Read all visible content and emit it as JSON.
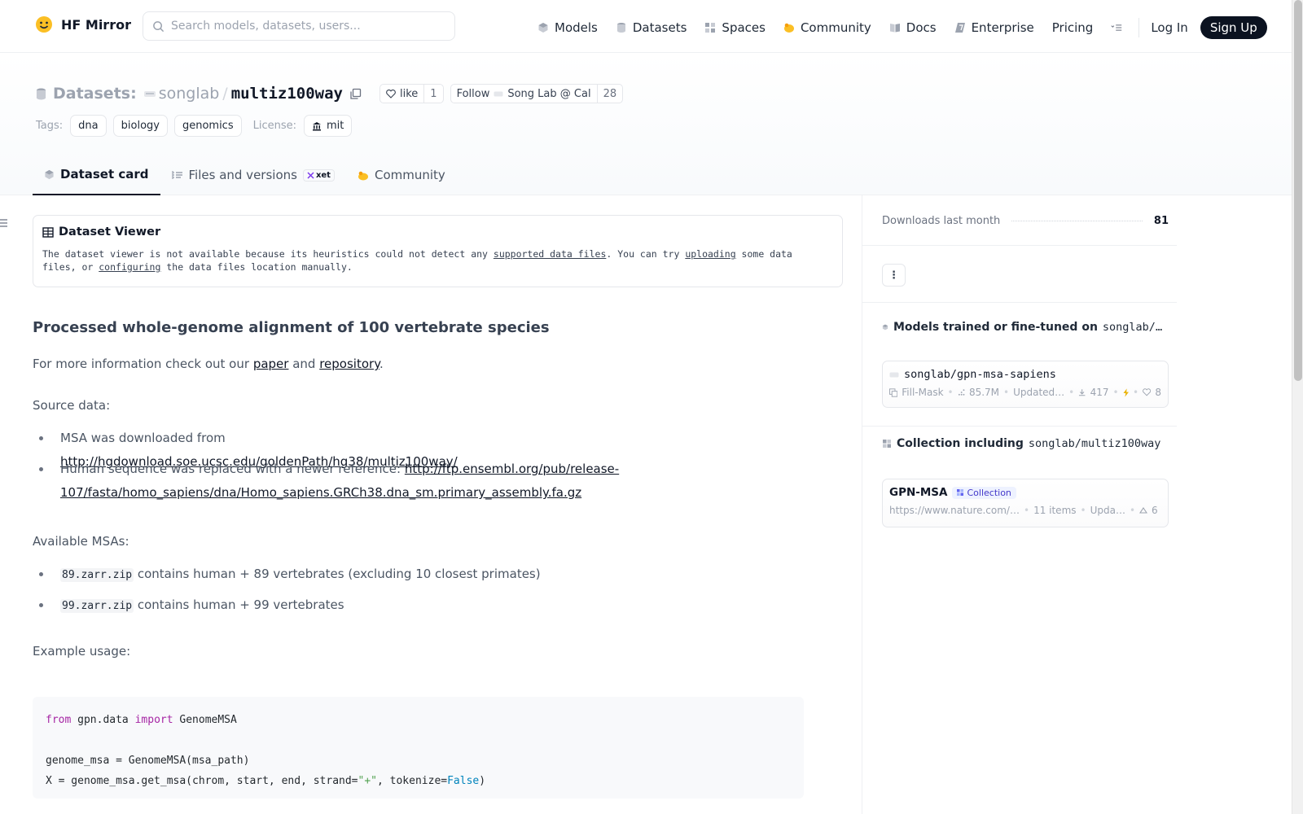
{
  "nav": {
    "brand": "HF Mirror",
    "search_placeholder": "Search models, datasets, users...",
    "links": [
      "Models",
      "Datasets",
      "Spaces",
      "Community",
      "Docs",
      "Enterprise",
      "Pricing"
    ],
    "login": "Log In",
    "signup": "Sign Up"
  },
  "header": {
    "prefix": "Datasets:",
    "owner": "songlab",
    "slash": "/",
    "name": "multiz100way",
    "like_label": "like",
    "like_count": "1",
    "follow_label": "Follow",
    "follow_org": "Song Lab @ Cal",
    "follow_count": "28",
    "tags_label": "Tags:",
    "tags": [
      "dna",
      "biology",
      "genomics"
    ],
    "license_label": "License:",
    "license": "mit"
  },
  "tabs": {
    "dataset_card": "Dataset card",
    "files": "Files and versions",
    "xet": "xet",
    "community": "Community"
  },
  "viewer": {
    "title": "Dataset Viewer",
    "t1": "The dataset viewer is not available because its heuristics could not detect any ",
    "link1": "supported data files",
    "t2": ". You can try ",
    "link2": "uploading",
    "t3": " some data",
    "t4": "files, or ",
    "link3": "configuring",
    "t5": " the data files location manually."
  },
  "content": {
    "heading": "Processed whole-genome alignment of 100 vertebrate species",
    "info_pre": "For more information check out our ",
    "info_paper": "paper",
    "info_and": " and ",
    "info_repo": "repository",
    "info_end": ".",
    "source_label": "Source data:",
    "b1_pre": "MSA was downloaded from ",
    "b1_link": "http://hgdownload.soe.ucsc.edu/goldenPath/hg38/multiz100way/",
    "b2_pre": "Human sequence was replaced with a newer reference: ",
    "b2_link1": "http://ftp.ensembl.org/pub/release-",
    "b2_link2": "107/fasta/homo_sapiens/dna/Homo_sapiens.GRCh38.dna_sm.primary_assembly.fa.gz",
    "msas_label": "Available MSAs:",
    "m1_code": "89.zarr.zip",
    "m1_text": " contains human + 89 vertebrates (excluding 10 closest primates)",
    "m2_code": "99.zarr.zip",
    "m2_text": " contains human + 99 vertebrates",
    "example_label": "Example usage:",
    "code": {
      "l1_kw1": "from",
      "l1_mod": " gpn.data ",
      "l1_kw2": "import",
      "l1_cls": " GenomeMSA",
      "l3": "genome_msa = GenomeMSA(msa_path)",
      "l4_pre": "X = genome_msa.get_msa(chrom, start, end, strand=",
      "l4_str": "\"+\"",
      "l4_mid": ", tokenize=",
      "l4_bool": "False",
      "l4_end": ")"
    }
  },
  "sidebar": {
    "downloads_label": "Downloads last month",
    "downloads_value": "81",
    "kebab": "⋮",
    "models_head": "Models trained or fine-tuned on",
    "models_ref": "songlab/multiz…",
    "model": {
      "name": "songlab/gpn-msa-sapiens",
      "task": "Fill-Mask",
      "params": "85.7M",
      "updated": "Updated…",
      "downloads": "417",
      "likes": "8"
    },
    "collection_head": "Collection including",
    "collection_ref": "songlab/multiz100way",
    "collection": {
      "name": "GPN-MSA",
      "badge": "Collection",
      "url": "https://www.nature.com/…",
      "items": "11 items",
      "updated": "Upda…",
      "upvotes": "6"
    }
  },
  "colors": {
    "accent_dark": "#0b1220",
    "link": "#111827",
    "keyword": "#a626a4",
    "string": "#50a14f",
    "boolean": "#0184bc"
  }
}
